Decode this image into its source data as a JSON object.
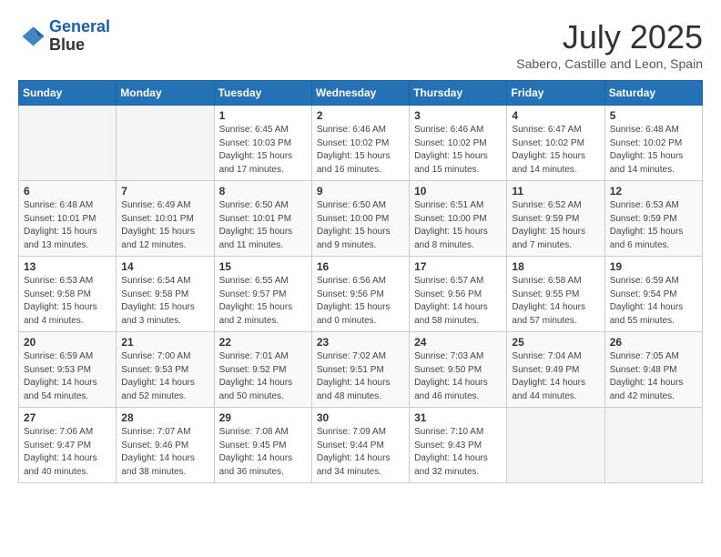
{
  "header": {
    "logo_line1": "General",
    "logo_line2": "Blue",
    "month_title": "July 2025",
    "location": "Sabero, Castille and Leon, Spain"
  },
  "weekdays": [
    "Sunday",
    "Monday",
    "Tuesday",
    "Wednesday",
    "Thursday",
    "Friday",
    "Saturday"
  ],
  "weeks": [
    [
      {
        "day": "",
        "info": ""
      },
      {
        "day": "",
        "info": ""
      },
      {
        "day": "1",
        "info": "Sunrise: 6:45 AM\nSunset: 10:03 PM\nDaylight: 15 hours\nand 17 minutes."
      },
      {
        "day": "2",
        "info": "Sunrise: 6:46 AM\nSunset: 10:02 PM\nDaylight: 15 hours\nand 16 minutes."
      },
      {
        "day": "3",
        "info": "Sunrise: 6:46 AM\nSunset: 10:02 PM\nDaylight: 15 hours\nand 15 minutes."
      },
      {
        "day": "4",
        "info": "Sunrise: 6:47 AM\nSunset: 10:02 PM\nDaylight: 15 hours\nand 14 minutes."
      },
      {
        "day": "5",
        "info": "Sunrise: 6:48 AM\nSunset: 10:02 PM\nDaylight: 15 hours\nand 14 minutes."
      }
    ],
    [
      {
        "day": "6",
        "info": "Sunrise: 6:48 AM\nSunset: 10:01 PM\nDaylight: 15 hours\nand 13 minutes."
      },
      {
        "day": "7",
        "info": "Sunrise: 6:49 AM\nSunset: 10:01 PM\nDaylight: 15 hours\nand 12 minutes."
      },
      {
        "day": "8",
        "info": "Sunrise: 6:50 AM\nSunset: 10:01 PM\nDaylight: 15 hours\nand 11 minutes."
      },
      {
        "day": "9",
        "info": "Sunrise: 6:50 AM\nSunset: 10:00 PM\nDaylight: 15 hours\nand 9 minutes."
      },
      {
        "day": "10",
        "info": "Sunrise: 6:51 AM\nSunset: 10:00 PM\nDaylight: 15 hours\nand 8 minutes."
      },
      {
        "day": "11",
        "info": "Sunrise: 6:52 AM\nSunset: 9:59 PM\nDaylight: 15 hours\nand 7 minutes."
      },
      {
        "day": "12",
        "info": "Sunrise: 6:53 AM\nSunset: 9:59 PM\nDaylight: 15 hours\nand 6 minutes."
      }
    ],
    [
      {
        "day": "13",
        "info": "Sunrise: 6:53 AM\nSunset: 9:58 PM\nDaylight: 15 hours\nand 4 minutes."
      },
      {
        "day": "14",
        "info": "Sunrise: 6:54 AM\nSunset: 9:58 PM\nDaylight: 15 hours\nand 3 minutes."
      },
      {
        "day": "15",
        "info": "Sunrise: 6:55 AM\nSunset: 9:57 PM\nDaylight: 15 hours\nand 2 minutes."
      },
      {
        "day": "16",
        "info": "Sunrise: 6:56 AM\nSunset: 9:56 PM\nDaylight: 15 hours\nand 0 minutes."
      },
      {
        "day": "17",
        "info": "Sunrise: 6:57 AM\nSunset: 9:56 PM\nDaylight: 14 hours\nand 58 minutes."
      },
      {
        "day": "18",
        "info": "Sunrise: 6:58 AM\nSunset: 9:55 PM\nDaylight: 14 hours\nand 57 minutes."
      },
      {
        "day": "19",
        "info": "Sunrise: 6:59 AM\nSunset: 9:54 PM\nDaylight: 14 hours\nand 55 minutes."
      }
    ],
    [
      {
        "day": "20",
        "info": "Sunrise: 6:59 AM\nSunset: 9:53 PM\nDaylight: 14 hours\nand 54 minutes."
      },
      {
        "day": "21",
        "info": "Sunrise: 7:00 AM\nSunset: 9:53 PM\nDaylight: 14 hours\nand 52 minutes."
      },
      {
        "day": "22",
        "info": "Sunrise: 7:01 AM\nSunset: 9:52 PM\nDaylight: 14 hours\nand 50 minutes."
      },
      {
        "day": "23",
        "info": "Sunrise: 7:02 AM\nSunset: 9:51 PM\nDaylight: 14 hours\nand 48 minutes."
      },
      {
        "day": "24",
        "info": "Sunrise: 7:03 AM\nSunset: 9:50 PM\nDaylight: 14 hours\nand 46 minutes."
      },
      {
        "day": "25",
        "info": "Sunrise: 7:04 AM\nSunset: 9:49 PM\nDaylight: 14 hours\nand 44 minutes."
      },
      {
        "day": "26",
        "info": "Sunrise: 7:05 AM\nSunset: 9:48 PM\nDaylight: 14 hours\nand 42 minutes."
      }
    ],
    [
      {
        "day": "27",
        "info": "Sunrise: 7:06 AM\nSunset: 9:47 PM\nDaylight: 14 hours\nand 40 minutes."
      },
      {
        "day": "28",
        "info": "Sunrise: 7:07 AM\nSunset: 9:46 PM\nDaylight: 14 hours\nand 38 minutes."
      },
      {
        "day": "29",
        "info": "Sunrise: 7:08 AM\nSunset: 9:45 PM\nDaylight: 14 hours\nand 36 minutes."
      },
      {
        "day": "30",
        "info": "Sunrise: 7:09 AM\nSunset: 9:44 PM\nDaylight: 14 hours\nand 34 minutes."
      },
      {
        "day": "31",
        "info": "Sunrise: 7:10 AM\nSunset: 9:43 PM\nDaylight: 14 hours\nand 32 minutes."
      },
      {
        "day": "",
        "info": ""
      },
      {
        "day": "",
        "info": ""
      }
    ]
  ]
}
